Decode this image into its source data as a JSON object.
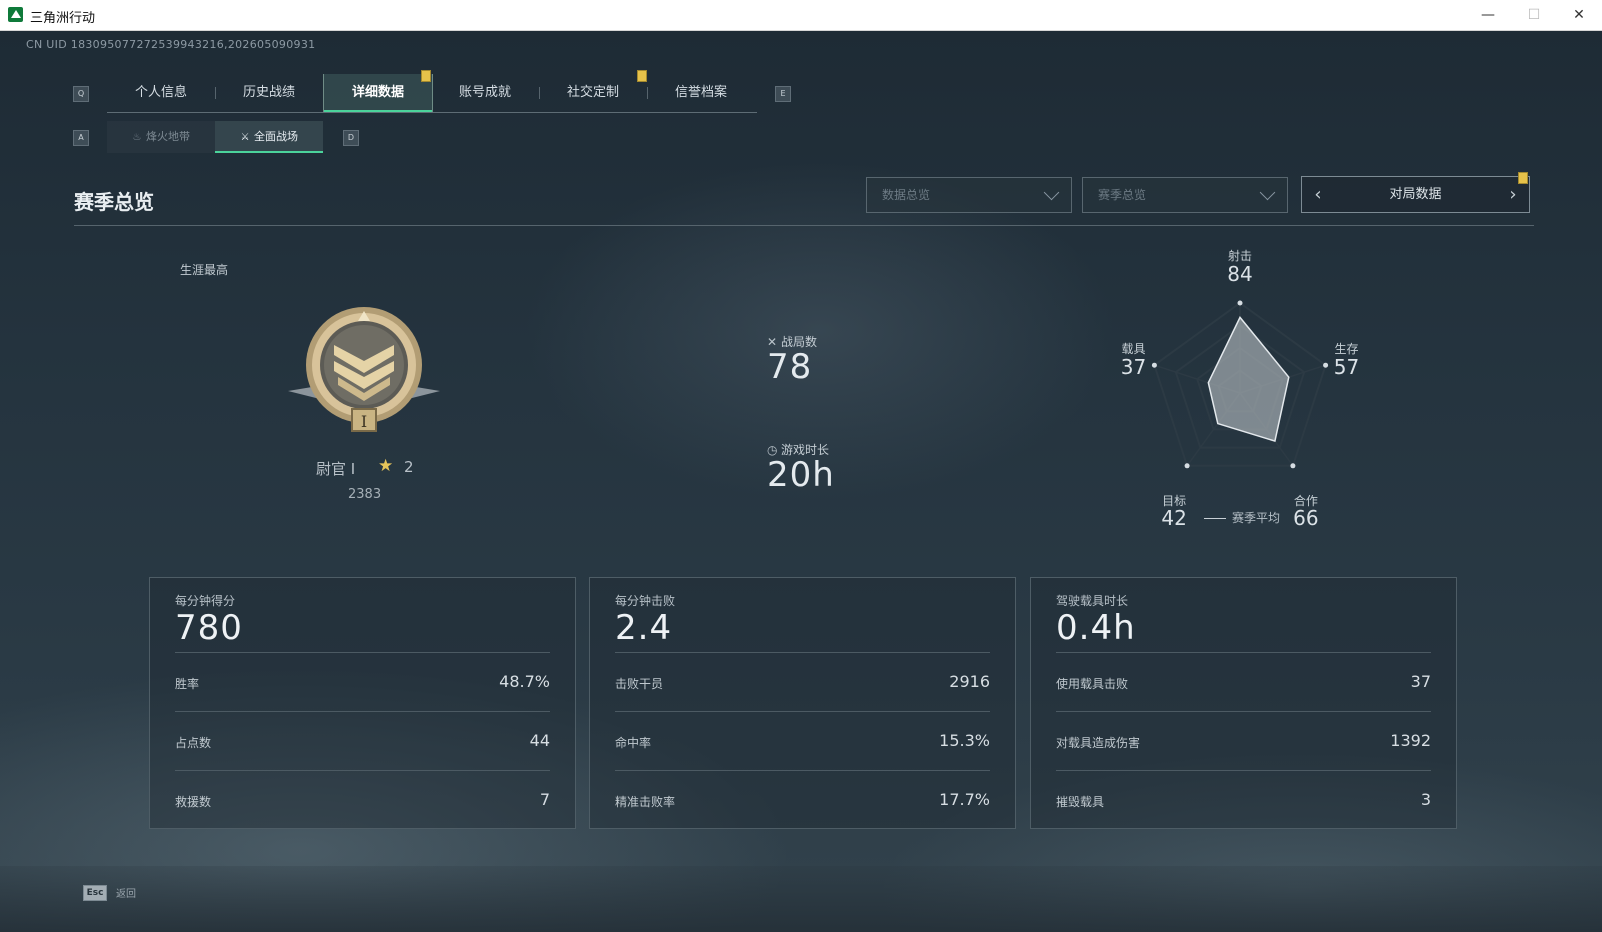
{
  "window": {
    "title": "三角洲行动",
    "minimize": "—",
    "maximize": "☐",
    "close": "✕"
  },
  "uid": "CN UID 1830950772725399432​16,202605090931",
  "keys": {
    "prev_tab": "Q",
    "next_tab": "E",
    "prev_sub": "A",
    "next_sub": "D",
    "esc": "Esc"
  },
  "tabs": [
    {
      "label": "个人信息"
    },
    {
      "label": "历史战绩"
    },
    {
      "label": "详细数据"
    },
    {
      "label": "账号成就"
    },
    {
      "label": "社交定制"
    },
    {
      "label": "信誉档案"
    }
  ],
  "subtabs": [
    {
      "label": "烽火地带"
    },
    {
      "label": "全面战场"
    }
  ],
  "section_title": "赛季总览",
  "filters": {
    "data_dropdown": "数据总览",
    "season_dropdown": "赛季总览",
    "pager_label": "对局数据"
  },
  "career": {
    "label": "生涯最高",
    "rank_name": "尉官 Ⅰ",
    "stars": "2",
    "points": "2383"
  },
  "summary": {
    "matches_label": "战局数",
    "matches_value": "78",
    "playtime_label": "游戏时长",
    "playtime_value": "20h"
  },
  "radar": {
    "legend": "赛季平均",
    "axes": [
      {
        "label": "射击",
        "value": 84
      },
      {
        "label": "生存",
        "value": 57
      },
      {
        "label": "合作",
        "value": 66
      },
      {
        "label": "目标",
        "value": 42
      },
      {
        "label": "载具",
        "value": 37
      }
    ]
  },
  "cards": [
    {
      "head_label": "每分钟得分",
      "head_value": "780",
      "rows": [
        {
          "label": "胜率",
          "value": "48.7%"
        },
        {
          "label": "占点数",
          "value": "44"
        },
        {
          "label": "救援数",
          "value": "7"
        }
      ]
    },
    {
      "head_label": "每分钟击败",
      "head_value": "2.4",
      "rows": [
        {
          "label": "击败干员",
          "value": "2916"
        },
        {
          "label": "命中率",
          "value": "15.3%"
        },
        {
          "label": "精准击败率",
          "value": "17.7%"
        }
      ]
    },
    {
      "head_label": "驾驶载具时长",
      "head_value": "0.4h",
      "rows": [
        {
          "label": "使用载具击败",
          "value": "37"
        },
        {
          "label": "对载具造成伤害",
          "value": "1392"
        },
        {
          "label": "摧毁载具",
          "value": "3"
        }
      ]
    }
  ],
  "footer": {
    "back_label": "返回"
  },
  "colors": {
    "accent": "#4bd39b",
    "badge": "#e6c24a",
    "star": "#e6c55a"
  }
}
